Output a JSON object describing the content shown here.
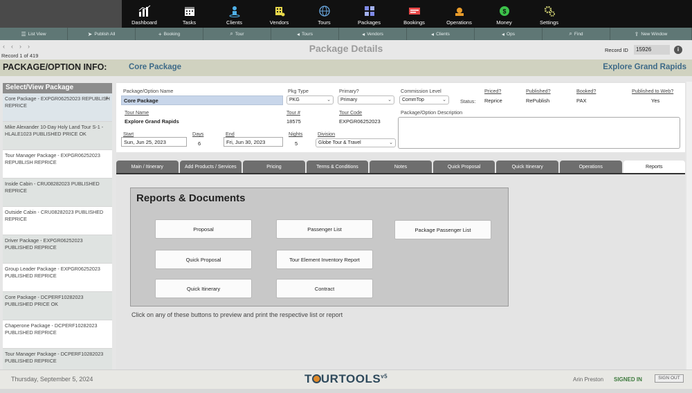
{
  "nav": {
    "items": [
      {
        "label": "Dashboard",
        "icon": "dashboard-icon",
        "color": "#ffffff"
      },
      {
        "label": "Tasks",
        "icon": "calendar-icon",
        "color": "#ffffff"
      },
      {
        "label": "Clients",
        "icon": "clients-icon",
        "color": "#4fb0e8"
      },
      {
        "label": "Vendors",
        "icon": "vendors-icon",
        "color": "#e8d84a"
      },
      {
        "label": "Tours",
        "icon": "globe-icon",
        "color": "#6aa8e0"
      },
      {
        "label": "Packages",
        "icon": "packages-icon",
        "color": "#7f8ae8"
      },
      {
        "label": "Bookings",
        "icon": "bookings-icon",
        "color": "#e84a4a"
      },
      {
        "label": "Operations",
        "icon": "operations-icon",
        "color": "#e89b2a"
      },
      {
        "label": "Money",
        "icon": "money-icon",
        "color": "#3cc24a"
      },
      {
        "label": "Settings",
        "icon": "gear-icon",
        "color": "#c9c970"
      }
    ]
  },
  "toolbar": {
    "items": [
      {
        "label": "List View",
        "glyph": "☰"
      },
      {
        "label": "Publish All",
        "glyph": "➤"
      },
      {
        "label": "Booking",
        "glyph": "+"
      },
      {
        "label": "Tour",
        "glyph": "⌕"
      },
      {
        "label": "Tours",
        "glyph": "◂"
      },
      {
        "label": "Vendors",
        "glyph": "◂"
      },
      {
        "label": "Clients",
        "glyph": "◂"
      },
      {
        "label": "Ops",
        "glyph": "◂"
      },
      {
        "label": "Find",
        "glyph": "⌕"
      },
      {
        "label": "New Window",
        "glyph": "⇪"
      }
    ]
  },
  "record": {
    "of_text": "Record 1 of 419",
    "page_title": "Package Details",
    "id_label": "Record ID",
    "id_value": "15926"
  },
  "header": {
    "label": "PACKAGE/OPTION INFO:",
    "package_name": "Core Package",
    "tour_name": "Explore Grand Rapids"
  },
  "sidebar": {
    "title": "Select/View Package",
    "items": [
      "Core Package - EXPGR06252023 REPUBLISH REPRICE",
      "Mike Alexander 10-Day Holy Land Tour S-1 - HLALE1023 PUBLISHED PRICE OK",
      "Tour Manager Package - EXPGR06252023 REPUBLISH REPRICE",
      "Inside Cabin - CRU08282023 PUBLISHED REPRICE",
      "Outside Cabin - CRU08282023 PUBLISHED REPRICE",
      "Driver Package - EXPGR06252023 PUBLISHED REPRICE",
      "Group Leader Package - EXPGR06252023 PUBLISHED REPRICE",
      "Core Package - DCPERF10282023 PUBLISHED PRICE OK",
      "Chaperone Package - DCPERF10282023 PUBLISHED REPRICE",
      "Tour Manager Package - DCPERF10282023 PUBLISHED REPRICE"
    ]
  },
  "form": {
    "pkg_name_label": "Package/Option Name",
    "pkg_name_value": "Core Package",
    "pkg_type_label": "Pkg Type",
    "pkg_type_value": "PKG",
    "primary_label": "Primary?",
    "primary_value": "Primary",
    "commission_label": "Commission Level",
    "commission_value": "CommTop",
    "status_label": "Status:",
    "priced_label": "Priced?",
    "priced_value": "Reprice",
    "published_label": "Published?",
    "published_value": "RePublish",
    "booked_label": "Booked?",
    "booked_value": "PAX",
    "web_label": "Published to Web?",
    "web_value": "Yes",
    "tour_name_label": "Tour Name",
    "tour_name_value": "Explore Grand Rapids",
    "tour_num_label": "Tour #",
    "tour_num_value": "18575",
    "tour_code_label": "Tour Code",
    "tour_code_value": "EXPGR06252023",
    "desc_label": "Package/Option Description",
    "start_label": "Start",
    "start_value": "Sun, Jun 25, 2023",
    "days_label": "Days",
    "days_value": "6",
    "end_label": "End",
    "end_value": "Fri, Jun 30, 2023",
    "nights_label": "Nights",
    "nights_value": "5",
    "division_label": "Division",
    "division_value": "Globe Tour & Travel"
  },
  "tabs": [
    "Main / Itinerary",
    "Add Products / Services",
    "Pricing",
    "Terms & Conditions",
    "Notes",
    "Quick Proposal",
    "Quick Itinerary",
    "Operations",
    "Reports"
  ],
  "active_tab": "Reports",
  "reports": {
    "title": "Reports & Documents",
    "buttons": [
      "Proposal",
      "Passenger List",
      "Package Passenger List",
      "Quick Proposal",
      "Tour Element Inventory Report",
      "Quick Itinerary",
      "Contract"
    ],
    "hint": "Click on any of these buttons to preview and print the respective list or report"
  },
  "footer": {
    "date": "Thursday, September 5, 2024",
    "logo_pre": "T",
    "logo_post": "URTOOLS",
    "logo_version": "v5",
    "user": "Arin Preston",
    "signed": "SIGNED IN",
    "signout": "SIGN OUT"
  }
}
